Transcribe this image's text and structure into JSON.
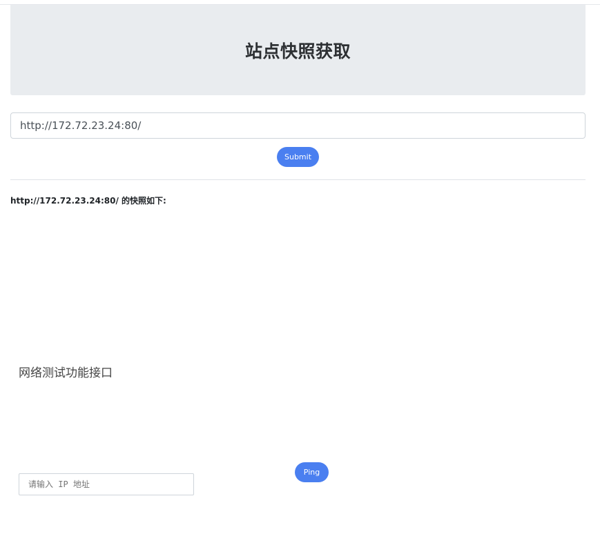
{
  "header": {
    "title": "站点快照获取"
  },
  "snapshot_form": {
    "url_value": "http://172.72.23.24:80/",
    "submit_label": "Submit"
  },
  "snapshot_result": {
    "label": "http://172.72.23.24:80/ 的快照如下:"
  },
  "network_test": {
    "heading": "网络测试功能接口",
    "ip_placeholder": "请输入 IP 地址",
    "ip_value": "",
    "ping_label": "Ping"
  },
  "colors": {
    "header_bg": "#e9ecef",
    "button_accent": "#4a7ff0"
  }
}
